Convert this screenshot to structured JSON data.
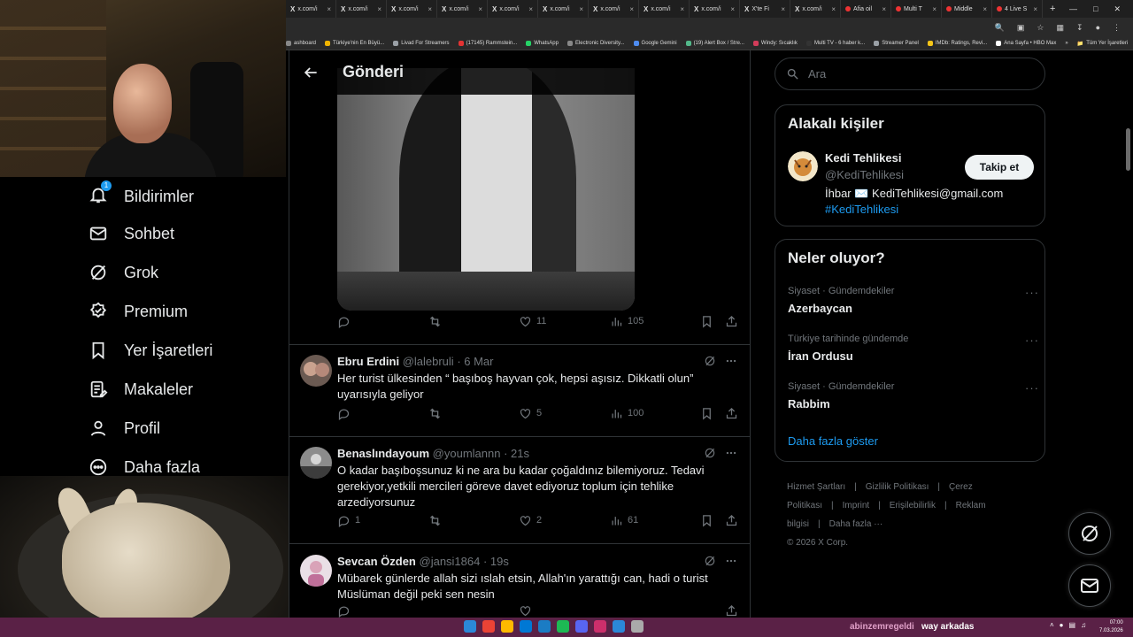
{
  "browser": {
    "tabs": [
      {
        "label": "x.com/i",
        "fav": "X"
      },
      {
        "label": "x.com/i",
        "fav": "X"
      },
      {
        "label": "x.com/i",
        "fav": "X"
      },
      {
        "label": "x.com/i",
        "fav": "X"
      },
      {
        "label": "x.com/i",
        "fav": "X"
      },
      {
        "label": "x.com/i",
        "fav": "X"
      },
      {
        "label": "x.com/i",
        "fav": "X"
      },
      {
        "label": "x.com/i",
        "fav": "X"
      },
      {
        "label": "x.com/i",
        "fav": "X"
      },
      {
        "label": "X'te Fi",
        "fav": "X"
      },
      {
        "label": "x.com/i",
        "fav": "X"
      },
      {
        "label": "Afia oil",
        "fav": ""
      },
      {
        "label": "Multi T",
        "fav": ""
      },
      {
        "label": "Middle",
        "fav": ""
      },
      {
        "label": "4 Live S",
        "fav": ""
      }
    ],
    "new_tab": "+",
    "close_glyph": "×",
    "bookmarks": [
      {
        "label": "ashboard",
        "color": "#888888"
      },
      {
        "label": "Türkiye'nin En Büyü...",
        "color": "#f0b400"
      },
      {
        "label": "Livad For Streamers",
        "color": "#9aa0a6"
      },
      {
        "label": "(17145) Rammstein...",
        "color": "#e33333"
      },
      {
        "label": "WhatsApp",
        "color": "#25d366"
      },
      {
        "label": "Electronic Diversity...",
        "color": "#888888"
      },
      {
        "label": "Google Gemini",
        "color": "#4e8cf0"
      },
      {
        "label": "(19) Alert Box / Stre...",
        "color": "#53b88a"
      },
      {
        "label": "Windy: Sıcaklık",
        "color": "#d23c5a"
      },
      {
        "label": "Multi TV - 6 haber k...",
        "color": "#333333"
      },
      {
        "label": "Streamer Panel",
        "color": "#9aa0a6"
      },
      {
        "label": "IMDb: Ratings, Revi...",
        "color": "#f5c518"
      },
      {
        "label": "Ana Sayfa • HBO Max",
        "color": "#ffffff"
      }
    ],
    "bookmarks_more": "»",
    "all_bookmarks": "Tüm Yer İşaretleri"
  },
  "nav": {
    "notifications_label": "Bildirimler",
    "notifications_badge": "1",
    "messages_label": "Sohbet",
    "grok_label": "Grok",
    "premium_label": "Premium",
    "bookmarks_label": "Yer İşaretleri",
    "articles_label": "Makaleler",
    "profile_label": "Profil",
    "more_label": "Daha fazla"
  },
  "header": {
    "title": "Gönderi"
  },
  "main_post": {
    "likes": "11",
    "views": "105"
  },
  "replies": [
    {
      "name": "Ebru Erdini",
      "handle": "@lalebruli",
      "time": "· 6 Mar",
      "text": "Her turist ülkesinden “ başıboş hayvan çok, hepsi aşısız. Dikkatli olun” uyarısıyla geliyor",
      "replies": "",
      "reposts": "",
      "likes": "5",
      "views": "100"
    },
    {
      "name": "Benaslındayoum",
      "handle": "@youmlannn",
      "time": "· 21s",
      "text": "O kadar başıboşsunuz ki ne ara bu kadar çoğaldınız bilemiyoruz. Tedavi gerekiyor,yetkili mercileri göreve davet ediyoruz toplum için tehlike arzediyorsunuz",
      "replies": "1",
      "reposts": "",
      "likes": "2",
      "views": "61"
    },
    {
      "name": "Sevcan Özden",
      "handle": "@jansi1864",
      "time": "· 19s",
      "text": "Mübarek günlerde allah sizi ıslah etsin, Allah'ın yarattığı can, hadi o turist Müslüman değil peki sen nesin",
      "replies": "",
      "reposts": "",
      "likes": "",
      "views": ""
    }
  ],
  "search": {
    "placeholder": "Ara"
  },
  "related": {
    "title": "Alakalı kişiler",
    "name": "Kedi Tehlikesi",
    "handle": "@KediTehlikesi",
    "bio": "İhbar ✉️ KediTehlikesi@gmail.com",
    "hashtag": "#KediTehlikesi",
    "follow_label": "Takip et"
  },
  "trends": {
    "title": "Neler oluyor?",
    "items": [
      {
        "category": "Siyaset · Gündemdekiler",
        "name": "Azerbaycan"
      },
      {
        "category": "Türkiye tarihinde gündemde",
        "name": "İran Ordusu"
      },
      {
        "category": "Siyaset · Gündemdekiler",
        "name": "Rabbim"
      }
    ],
    "show_more": "Daha fazla göster"
  },
  "footer": {
    "links": [
      "Hizmet Şartları",
      "|",
      "Gizlilik Politikası",
      "|",
      "Çerez Politikası",
      "|",
      "Imprint",
      "|",
      "Erişilebilirlik",
      "|",
      "Reklam bilgisi",
      "|",
      "Daha fazla ···"
    ],
    "copyright": "© 2026 X Corp."
  },
  "taskbar": {
    "text_pink": "abinzemregeldi",
    "text_white": "way arkadas",
    "time": "07:00",
    "date": "7.03.2026",
    "icon_colors": [
      "#2b88d8",
      "#ea4335",
      "#ffb900",
      "#0078d4",
      "#1b7cc4",
      "#1db954",
      "#5865f2",
      "#cc2f6b",
      "#2b88d8",
      "#aaaaaa"
    ]
  },
  "colors": {
    "accent": "#1d9bf0",
    "background": "#000000",
    "border": "#2f3336",
    "muted": "#71767b",
    "taskbar": "#5a2146"
  }
}
